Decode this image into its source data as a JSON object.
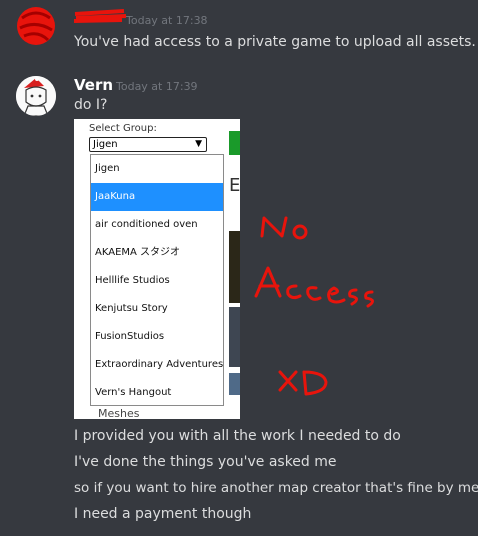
{
  "messages": [
    {
      "author": "",
      "timestamp": "Today at 17:38",
      "lines": [
        "You've had access to a private game to upload all assets."
      ]
    },
    {
      "author": "Vern",
      "timestamp": "Today at 17:39",
      "lines": [
        "do I?",
        "I provided you with all the work I needed to do",
        "I've done the things you've asked me",
        "so if you want to hire another map creator that's fine by me",
        "I need a payment though"
      ]
    }
  ],
  "screenshot": {
    "label": "Select Group:",
    "selected": "Jigen",
    "options": [
      "Jigen",
      "JaaKuna",
      "air conditioned oven",
      "AKAEMA スタジオ",
      "Helllife Studios",
      "Kenjutsu Story",
      "FusionStudios",
      "Extraordinary Adventures",
      "Vern's Hangout"
    ],
    "highlighted_option": "JaaKuna",
    "below_text": "Meshes",
    "partial_letter": "E"
  },
  "annotations": {
    "color": "#e8140c",
    "texts": [
      "No",
      "Access",
      "XD"
    ]
  },
  "colors": {
    "background": "#36393f",
    "text": "#dcddde",
    "timestamp": "#72767d",
    "highlight": "#1e90ff"
  }
}
